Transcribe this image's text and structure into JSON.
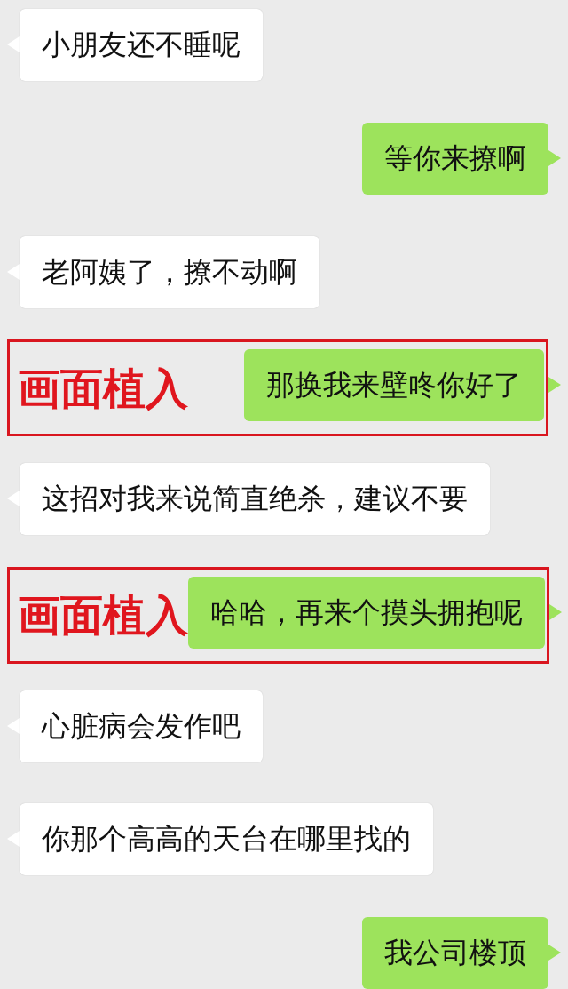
{
  "messages": [
    {
      "kind": "received",
      "text": "小朋友还不睡呢"
    },
    {
      "kind": "sent",
      "text": "等你来撩啊"
    },
    {
      "kind": "received",
      "text": "老阿姨了，撩不动啊"
    },
    {
      "kind": "sent",
      "text": "那换我来壁咚你好了",
      "annotation": "画面植入"
    },
    {
      "kind": "received",
      "text": "这招对我来说简直绝杀，建议不要"
    },
    {
      "kind": "sent",
      "text": "哈哈，再来个摸头拥抱呢",
      "annotation": "画面植入"
    },
    {
      "kind": "received",
      "text": "心脏病会发作吧"
    },
    {
      "kind": "received",
      "text": "你那个高高的天台在哪里找的"
    },
    {
      "kind": "sent",
      "text": "我公司楼顶"
    }
  ]
}
